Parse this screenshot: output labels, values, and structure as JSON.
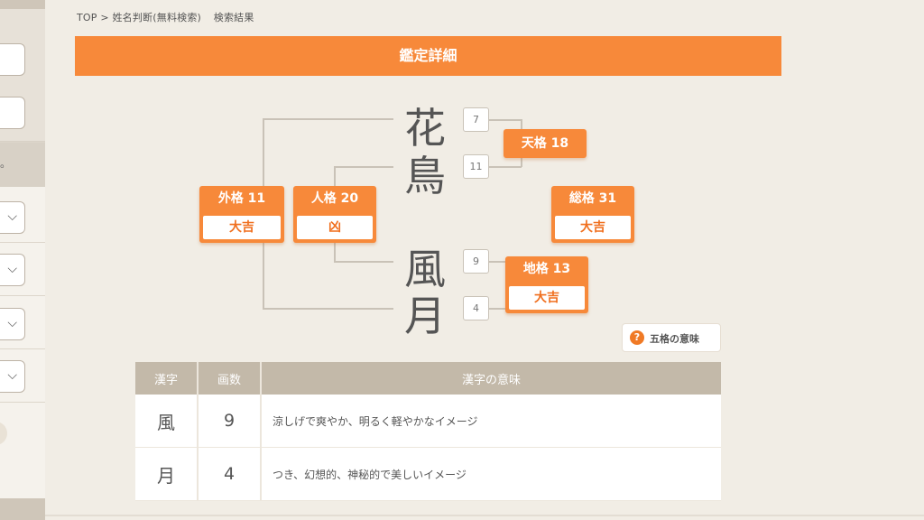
{
  "breadcrumb": {
    "top": "TOP",
    "sep": ">",
    "page": "姓名判断(無料検索)",
    "current": "検索結果"
  },
  "title": "鑑定詳細",
  "name": {
    "kanji": [
      "花",
      "鳥",
      "風",
      "月"
    ],
    "strokes": [
      "7",
      "11",
      "9",
      "4"
    ]
  },
  "kaku": {
    "tenkaku": {
      "label": "天格 18"
    },
    "jinkaku": {
      "label": "人格 20",
      "luck": "凶"
    },
    "chikaku": {
      "label": "地格 13",
      "luck": "大吉"
    },
    "gaikaku": {
      "label": "外格 11",
      "luck": "大吉"
    },
    "soukaku": {
      "label": "総格 31",
      "luck": "大吉"
    }
  },
  "meaning_button": {
    "icon": "question-icon",
    "glyph": "?",
    "label": "五格の意味"
  },
  "table": {
    "headers": [
      "漢字",
      "画数",
      "漢字の意味"
    ],
    "rows": [
      {
        "kanji": "風",
        "strokes": "9",
        "meaning": "涼しげで爽やか、明るく軽やかなイメージ"
      },
      {
        "kanji": "月",
        "strokes": "4",
        "meaning": "つき、幻想的、神秘的で美しいイメージ"
      }
    ]
  },
  "sidebar": {
    "chevron": "⌵",
    "cut_text": "。"
  },
  "colors": {
    "accent": "#f7893a",
    "luck_text": "#f06f1e",
    "table_header": "#c3b9a9",
    "background": "#f1ede5"
  }
}
